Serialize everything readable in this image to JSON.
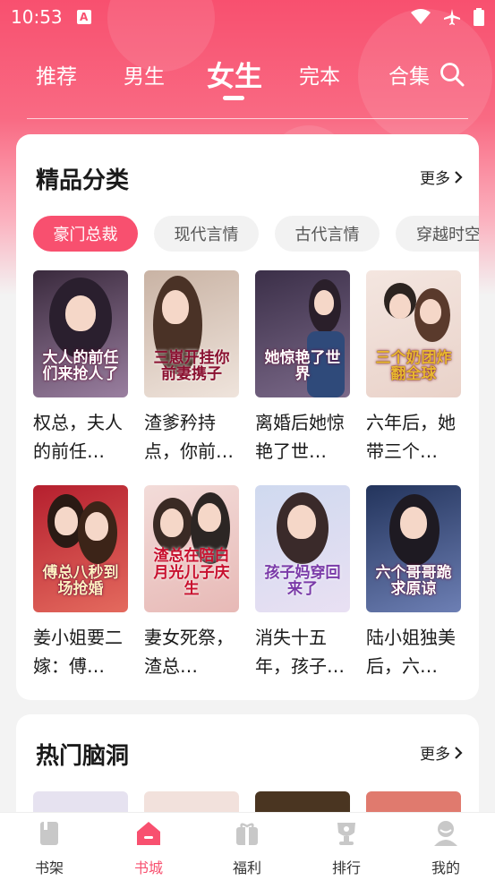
{
  "status": {
    "time": "10:53",
    "indicator": "A"
  },
  "topnav": {
    "tabs": [
      "推荐",
      "男生",
      "女生",
      "完本",
      "合集"
    ],
    "active_tab": "女生"
  },
  "section1": {
    "title": "精品分类",
    "more": "更多",
    "chips": [
      "豪门总裁",
      "现代言情",
      "古代言情",
      "穿越时空"
    ],
    "active_chip": "豪门总裁",
    "books": [
      {
        "title": "权总，夫人的前任们来抢人了！",
        "cover_text": "大人的前任们来抢人了",
        "cover_colors": [
          "#3a2a3d",
          "#9a7fa0"
        ]
      },
      {
        "title": "渣爹矜持点，你前妻携子挂了…",
        "cover_text": "三崽开挂你前妻携子",
        "cover_colors": [
          "#c9b3a4",
          "#efe4dc"
        ]
      },
      {
        "title": "离婚后她惊艳了世界",
        "cover_text": "她惊艳了世界",
        "cover_colors": [
          "#3b2f48",
          "#7c6a8a"
        ]
      },
      {
        "title": "六年后，她带三个奶团炸翻全球",
        "cover_text": "三个奶团炸翻全球",
        "cover_colors": [
          "#f4e6e0",
          "#e9d2c9"
        ]
      },
      {
        "title": "姜小姐要二嫁：傅总八秒到场抢婚",
        "cover_text": "傅总八秒到场抢婚",
        "cover_colors": [
          "#b51f2e",
          "#e46a5e"
        ]
      },
      {
        "title": "妻女死祭，渣总在陪白月光儿子庆生",
        "cover_text": "渣总在陪白月光儿子庆生",
        "cover_colors": [
          "#f3dcd9",
          "#e7b9b6"
        ]
      },
      {
        "title": "消失十五年，孩子妈穿回来了",
        "cover_text": "孩子妈穿回来了",
        "cover_colors": [
          "#cfd9ef",
          "#e9e0f3"
        ]
      },
      {
        "title": "陆小姐独美后，六个哥哥跪求原谅",
        "cover_text": "六个哥哥跪求原谅",
        "cover_colors": [
          "#23345c",
          "#6d7fb4"
        ]
      }
    ],
    "display_titles": [
      "权总，夫人的前任…",
      "渣爹矜持点，你前…",
      "离婚后她惊艳了世…",
      "六年后，她带三个…",
      "姜小姐要二嫁：傅…",
      "妻女死祭，渣总…",
      "消失十五年，孩子…",
      "陆小姐独美后，六…"
    ]
  },
  "section2": {
    "title": "热门脑洞",
    "more": "更多",
    "cover_colors": [
      "#e6e2f0",
      "#f2e1dc",
      "#4a3521",
      "#e07a6e"
    ]
  },
  "bottombar": {
    "items": [
      "书架",
      "书城",
      "福利",
      "排行",
      "我的"
    ],
    "active": "书城"
  },
  "colors": {
    "brand": "#f8506f"
  }
}
